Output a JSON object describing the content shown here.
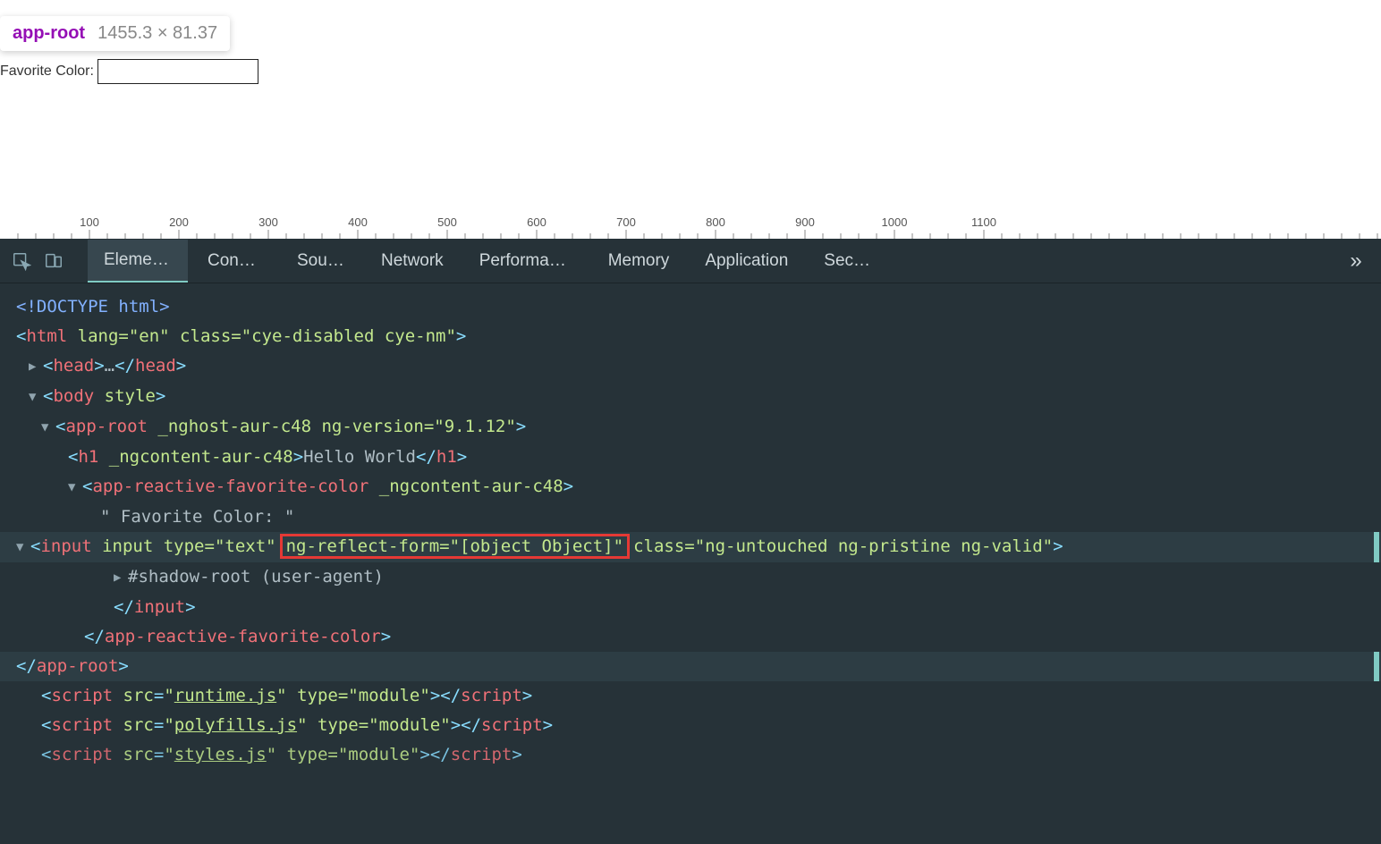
{
  "tooltip": {
    "name": "app-root",
    "dims": "1455.3 × 81.37"
  },
  "page": {
    "label": "Favorite Color:"
  },
  "ruler": {
    "ticks": [
      100,
      200,
      300,
      400,
      500,
      600,
      700,
      800,
      900,
      1000,
      1100
    ]
  },
  "tabs": [
    "Elemen…",
    "Conso…",
    "Sourc…",
    "Network",
    "Performan…",
    "Memory",
    "Application",
    "Securi…"
  ],
  "activeTab": "Elemen…",
  "dom": {
    "doctype": "<!DOCTYPE html>",
    "htmlOpen": {
      "tag": "html",
      "attrs": "lang=\"en\" class=\"cye-disabled cye-nm\""
    },
    "head": "<head>…</head>",
    "bodyOpen": {
      "tag": "body",
      "attrs": "style"
    },
    "appRootOpen": {
      "tag": "app-root",
      "attrs": "_nghost-aur-c48 ng-version=\"9.1.12\""
    },
    "h1": {
      "tag": "h1",
      "attrs": "_ngcontent-aur-c48",
      "text": "Hello World"
    },
    "favOpen": {
      "tag": "app-reactive-favorite-color",
      "attrs": "_ngcontent-aur-c48"
    },
    "favText": "\" Favorite Color: \"",
    "inputLine": {
      "pre": "input type=\"text\"",
      "boxed": "ng-reflect-form=\"[object Object]\"",
      "post": "class=\"ng-untouched ng-pristine ng-valid\""
    },
    "shadow": "#shadow-root (user-agent)",
    "inputClose": "</input>",
    "favClose": "</app-reactive-favorite-color>",
    "appRootClose": "</app-root>",
    "script1": {
      "src": "runtime.js",
      "type": "module"
    },
    "script2": {
      "src": "polyfills.js",
      "type": "module"
    },
    "script3": {
      "src": "styles.js",
      "type": "module"
    }
  }
}
